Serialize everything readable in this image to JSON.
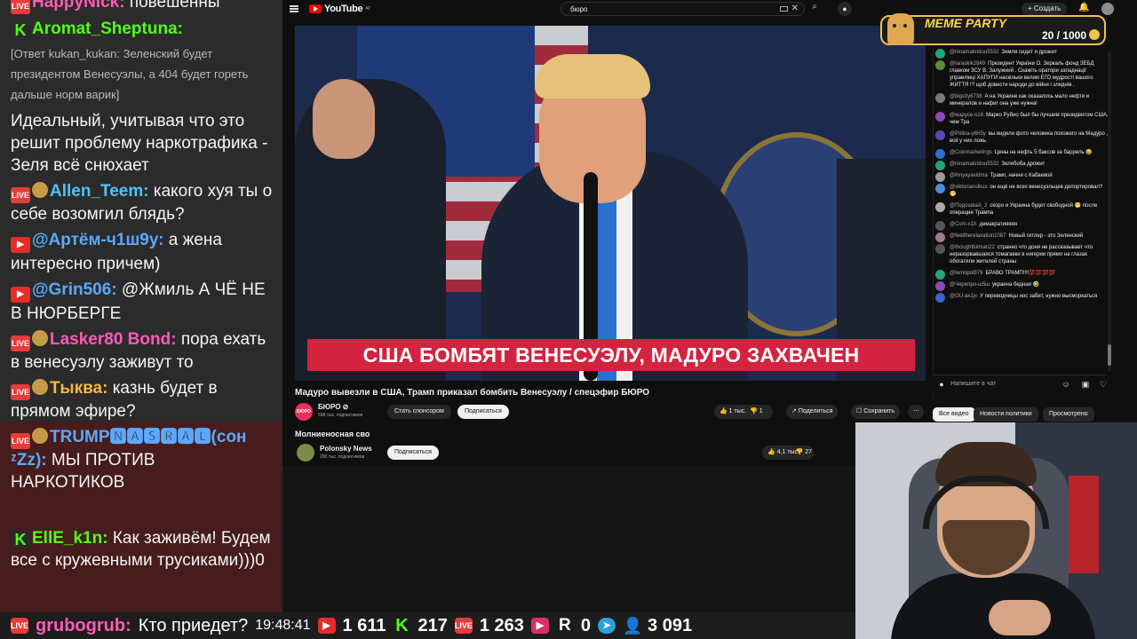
{
  "chat": {
    "top_partial": {
      "user": "HappyNick:",
      "text": "повешенны"
    },
    "messages": [
      {
        "badge": "K",
        "user": "Aromat_Sheptuna:",
        "reply": "[Ответ kukan_kukan: Зеленский будет президентом Венесуэлы, а 404 будет гореть дальше норм варик]",
        "text": "Идеальный, учитывая что это решит проблему наркотрафика - Зеля всё снюхает"
      },
      {
        "badge": "LIVE",
        "user": "Allen_Teem:",
        "text": "какого хуя ты о себе возомгил блядь?"
      },
      {
        "badge": "YT",
        "user": "@Артём-ч1ш9у:",
        "text": "а жена интересно причем)"
      },
      {
        "badge": "YT",
        "user": "@Grin506:",
        "text": "@Жмиль А ЧЁ НЕ В НЮРБЕРГЕ"
      },
      {
        "badge": "LIVE",
        "user": "Lasker80 Bond:",
        "text": "пора ехать в венесуэлу заживут то"
      },
      {
        "badge": "LIVE",
        "user": "Тыква:",
        "text": "казнь будет в прямом эфире?"
      },
      {
        "badge": "LIVE",
        "user": "TRUMP🅽🅰🆂🆁🅰🅻(сон ᶻZz):",
        "text": "МЫ ПРОТИВ НАРКОТИКОВ"
      },
      {
        "badge": "K",
        "user": "EllE_k1n:",
        "text": "Как заживём! Будем все с кружевными трусиками)))0"
      }
    ]
  },
  "statusbar": {
    "last_user": "grubogrub:",
    "last_text": "Кто приедет?",
    "time": "19:48:41",
    "youtube_viewers": "1 611",
    "kick_viewers": "217",
    "live_viewers": "1 263",
    "rutube_viewers": "0",
    "total_viewers": "3 091"
  },
  "youtube": {
    "logo_text": "YouTube",
    "logo_region": "AT",
    "search_value": "бюро",
    "create_label": "Создать",
    "video": {
      "caption": "США БОМБЯТ ВЕНЕСУЭЛУ, МАДУРО ЗАХВАЧЕН",
      "title": "Мадуро вывезли в США, Трамп приказал бомбить Венесуэлу / спецэфир БЮРО",
      "channel": "БЮРО ⊘",
      "channel_avatar_text": "БЮРО",
      "subs": "598 тыс. подписчиков",
      "sponsor_label": "Стать спонсором",
      "subscribe_label": "Подписаться",
      "likes": "1 тыс.",
      "dislikes": "1",
      "share_label": "Поделиться",
      "save_label": "Сохранить"
    },
    "next_video": {
      "title": "Молниеносная сво",
      "channel": "Polonsky News",
      "subs": "200 тыс. подписчиков",
      "subscribe_label": "Подписаться",
      "likes": "4,1 тыс.",
      "dislikes": "27"
    },
    "chips": [
      "Все видео",
      "Новости политики",
      "Просмотрено"
    ],
    "live_chat": {
      "placeholder": "Напишите в чат",
      "items": [
        {
          "user": "@ninamakridou5532",
          "text": "Земля сидит и дрожит",
          "color": "#1fa77a"
        },
        {
          "user": "@taraskik2849",
          "text": "Президент України О. Зеркаль фонд ЗЕБД главком ЗСУ В. Залужний . Скажіть оратори западнації управлінці ХАПУГИ наскільки великі ЕГО мудрості вашого ЖИТТЯ !? щоб довести народи до війни і злиднів .",
          "color": "#5b8c3a"
        },
        {
          "user": "@bigcity6738",
          "text": "А на Украине как оказалось мало нефти и минералов и нафиг она уже нужна!",
          "color": "#7a7a7a"
        },
        {
          "user": "@марусе-о16",
          "text": "Марко Рубио был бы лучшим президентом США, чем Тра",
          "color": "#8d4ab8"
        },
        {
          "user": "@Polina-y6h5y",
          "text": "вы видели фото человека похожего на Мадуро , всё у них ложь",
          "color": "#5e46b6"
        },
        {
          "user": "@Coinmarketings",
          "text": "Цены на нефть 5 баксов за баррель 😂",
          "color": "#2b6fd1"
        },
        {
          "user": "@ninamakridou5532",
          "text": "Зелебоба дрожит",
          "color": "#1fa77a"
        },
        {
          "user": "@ihnyayavidma",
          "text": "Трамп, начни с Кабаевой",
          "color": "#9b9b9b"
        },
        {
          "user": "@viktorianulkus",
          "text": "он ещё не всех венесуэльцев депортировал? 😁",
          "color": "#4a90d9"
        },
        {
          "user": "@ПодошваА_2",
          "text": "скоро и Украина будет свободной 😁 после операции Трампа",
          "color": "#aaaaaa"
        },
        {
          "user": "@Com-x1h",
          "text": "демакратияяяя",
          "color": "#555555"
        },
        {
          "user": "@feeltherelaxation1087",
          "text": "Новый гитлер - это Зеленский",
          "color": "#a07a92"
        },
        {
          "user": "@thoughtfulman22",
          "text": "странно что доня не рассказывает что неразорвавшаяся томагавки в нигерии прямо на глазах обогатили жителей страны",
          "color": "#555555"
        },
        {
          "user": "@temopol979",
          "text": "БРАВО ТРАМП!!!!💯💯💯💯",
          "color": "#1fa77a"
        },
        {
          "user": "@Черепро-ш5ш",
          "text": "украина бедная 🤣",
          "color": "#8d4ab8"
        },
        {
          "user": "@GU-ax1jx",
          "text": "У переводчицы нос забит, нужно высморкаться",
          "color": "#3a63c8"
        }
      ]
    }
  },
  "meme_party": {
    "title": "MEME PARTY",
    "count": "20 / 1000"
  }
}
